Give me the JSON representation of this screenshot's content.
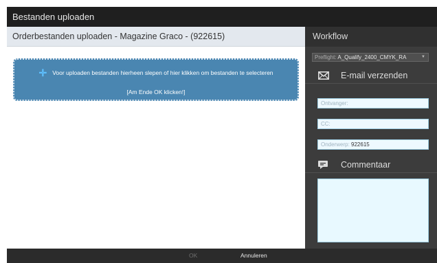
{
  "window": {
    "title": "Bestanden uploaden"
  },
  "main": {
    "header": "Orderbestanden uploaden - Magazine Graco - (922615)",
    "dropzone": {
      "instruction": "Voor uploaden bestanden hierheen slepen of hier klikken om bestanden te selecteren",
      "note": "[Am Ende OK klicken!]",
      "icon": "plus-icon"
    }
  },
  "sidebar": {
    "header": "Workflow",
    "preflight": {
      "label": "Preflight:",
      "value": "A_Qualify_2400_CMYK_RA"
    },
    "email": {
      "title": "E-mail verzenden",
      "icon": "envelope-icon",
      "recipient_placeholder": "Ontvanger:",
      "cc_placeholder": "CC:",
      "subject_label": "Onderwerp:",
      "subject_value": "922615"
    },
    "comment": {
      "title": "Commentaar",
      "icon": "comment-icon"
    }
  },
  "footer": {
    "ok_label": "OK",
    "cancel_label": "Annuleren"
  },
  "colors": {
    "dropzone": "#4a86b1",
    "sidebar": "#3c3c3c",
    "titlebar": "#1f1f1f",
    "field": "#eef9ff"
  }
}
